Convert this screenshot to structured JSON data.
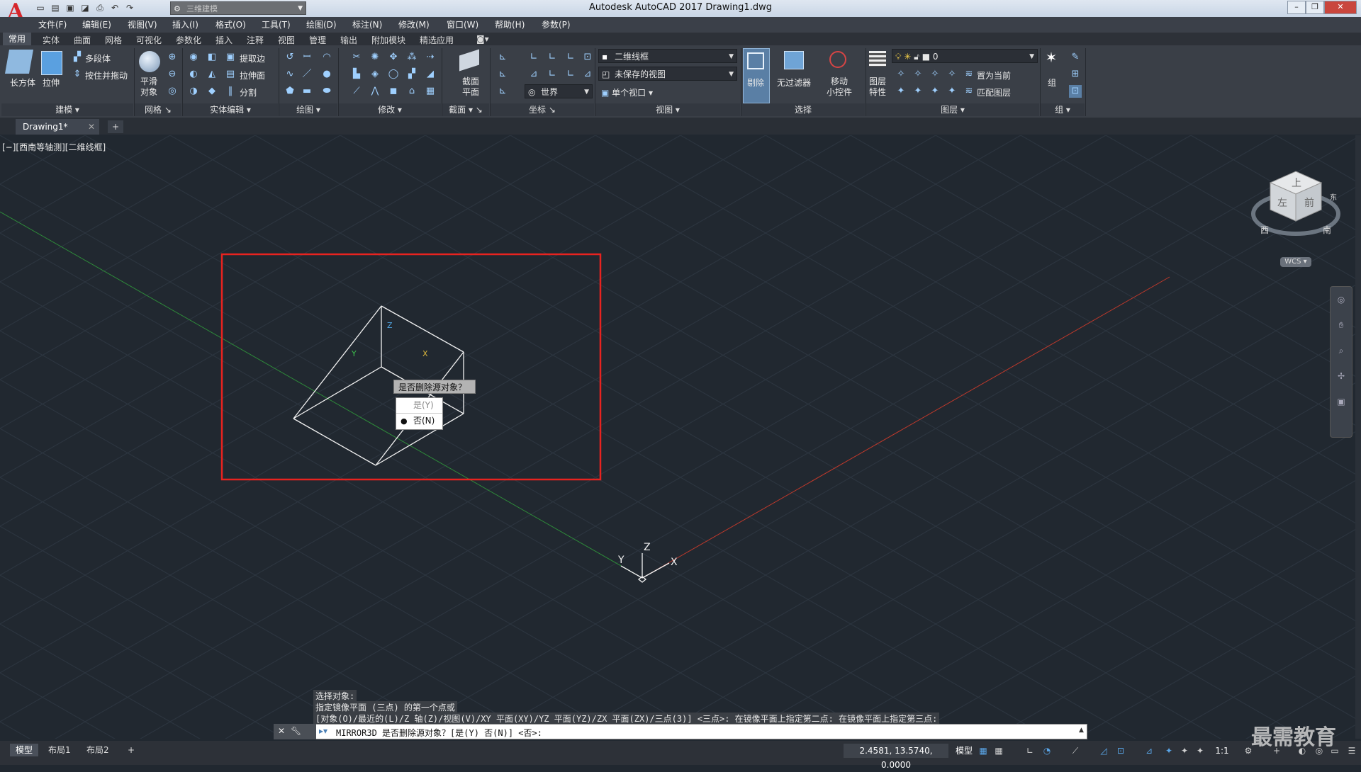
{
  "window": {
    "app_logo": "A",
    "title": "Autodesk AutoCAD 2017    Drawing1.dwg",
    "workspace": "三维建模",
    "controls": {
      "minimize": "–",
      "restore": "❐",
      "close": "✕"
    }
  },
  "menu": [
    "文件(F)",
    "编辑(E)",
    "视图(V)",
    "插入(I)",
    "格式(O)",
    "工具(T)",
    "绘图(D)",
    "标注(N)",
    "修改(M)",
    "窗口(W)",
    "帮助(H)",
    "参数(P)"
  ],
  "ribbon_tabs": [
    "常用",
    "实体",
    "曲面",
    "网格",
    "可视化",
    "参数化",
    "插入",
    "注释",
    "视图",
    "管理",
    "输出",
    "附加模块",
    "精选应用"
  ],
  "ribbon": {
    "modeling": {
      "box": "长方体",
      "extrude": "拉伸",
      "polysolid": "多段体",
      "presspull": "按住并拖动",
      "title": "建模"
    },
    "mesh": {
      "smooth_line1": "平滑",
      "smooth_line2": "对象",
      "title": "网格"
    },
    "solid_edit": {
      "extract": "提取边",
      "extrude_face": "拉伸面",
      "separate": "分割",
      "title": "实体编辑"
    },
    "draw": {
      "title": "绘图"
    },
    "modify": {
      "title": "修改"
    },
    "section": {
      "plane_line1": "截面",
      "plane_line2": "平面",
      "title": "截面"
    },
    "coords": {
      "world": "世界",
      "title": "坐标"
    },
    "view": {
      "visual_style": "二维线框",
      "saved_view": "未保存的视图",
      "viewport": "单个视口",
      "title": "视图"
    },
    "selection": {
      "cull": "剔除",
      "no_filter": "无过滤器",
      "gizmo_line1": "移动",
      "gizmo_line2": "小控件",
      "title": "选择"
    },
    "layers": {
      "props_line1": "图层",
      "props_line2": "特性",
      "layer_name": "0",
      "set_current": "置为当前",
      "match": "匹配图层",
      "title": "图层"
    },
    "groups": {
      "group": "组",
      "title": "组"
    }
  },
  "doc_tab": "Drawing1*",
  "viewport_label": "[−][西南等轴测][二维线框]",
  "viewcube": {
    "top": "上",
    "left": "左",
    "front": "前",
    "south": "南",
    "west": "西",
    "east": "东",
    "wcs": "WCS"
  },
  "axis_labels": {
    "x": "X",
    "y": "Y",
    "z": "Z"
  },
  "prompt": {
    "question": "是否删除源对象？",
    "options": [
      {
        "label": "是(Y)",
        "selected": false
      },
      {
        "label": "否(N)",
        "selected": true
      }
    ],
    "bullet": "●"
  },
  "history": [
    "选择对象:",
    "指定镜像平面 (三点) 的第一个点或",
    "  [对象(O)/最近的(L)/Z 轴(Z)/视图(V)/XY 平面(XY)/YZ 平面(YZ)/ZX 平面(ZX)/三点(3)] <三点>: 在镜像平面上指定第二点: 在镜像平面上指定第三点:"
  ],
  "command_line": "MIRROR3D 是否删除源对象？[是(Y) 否(N)] <否>:",
  "layout_tabs": [
    "模型",
    "布局1",
    "布局2"
  ],
  "status": {
    "coords": "2.4581, 13.5740, 0.0000",
    "model": "模型",
    "scale": "1:1"
  },
  "watermark": "最需教育",
  "colors": {
    "canvas": "#212830",
    "highlight_box": "#e8231f",
    "x_axis": "#c0392b",
    "y_axis": "#2e8b3a"
  }
}
